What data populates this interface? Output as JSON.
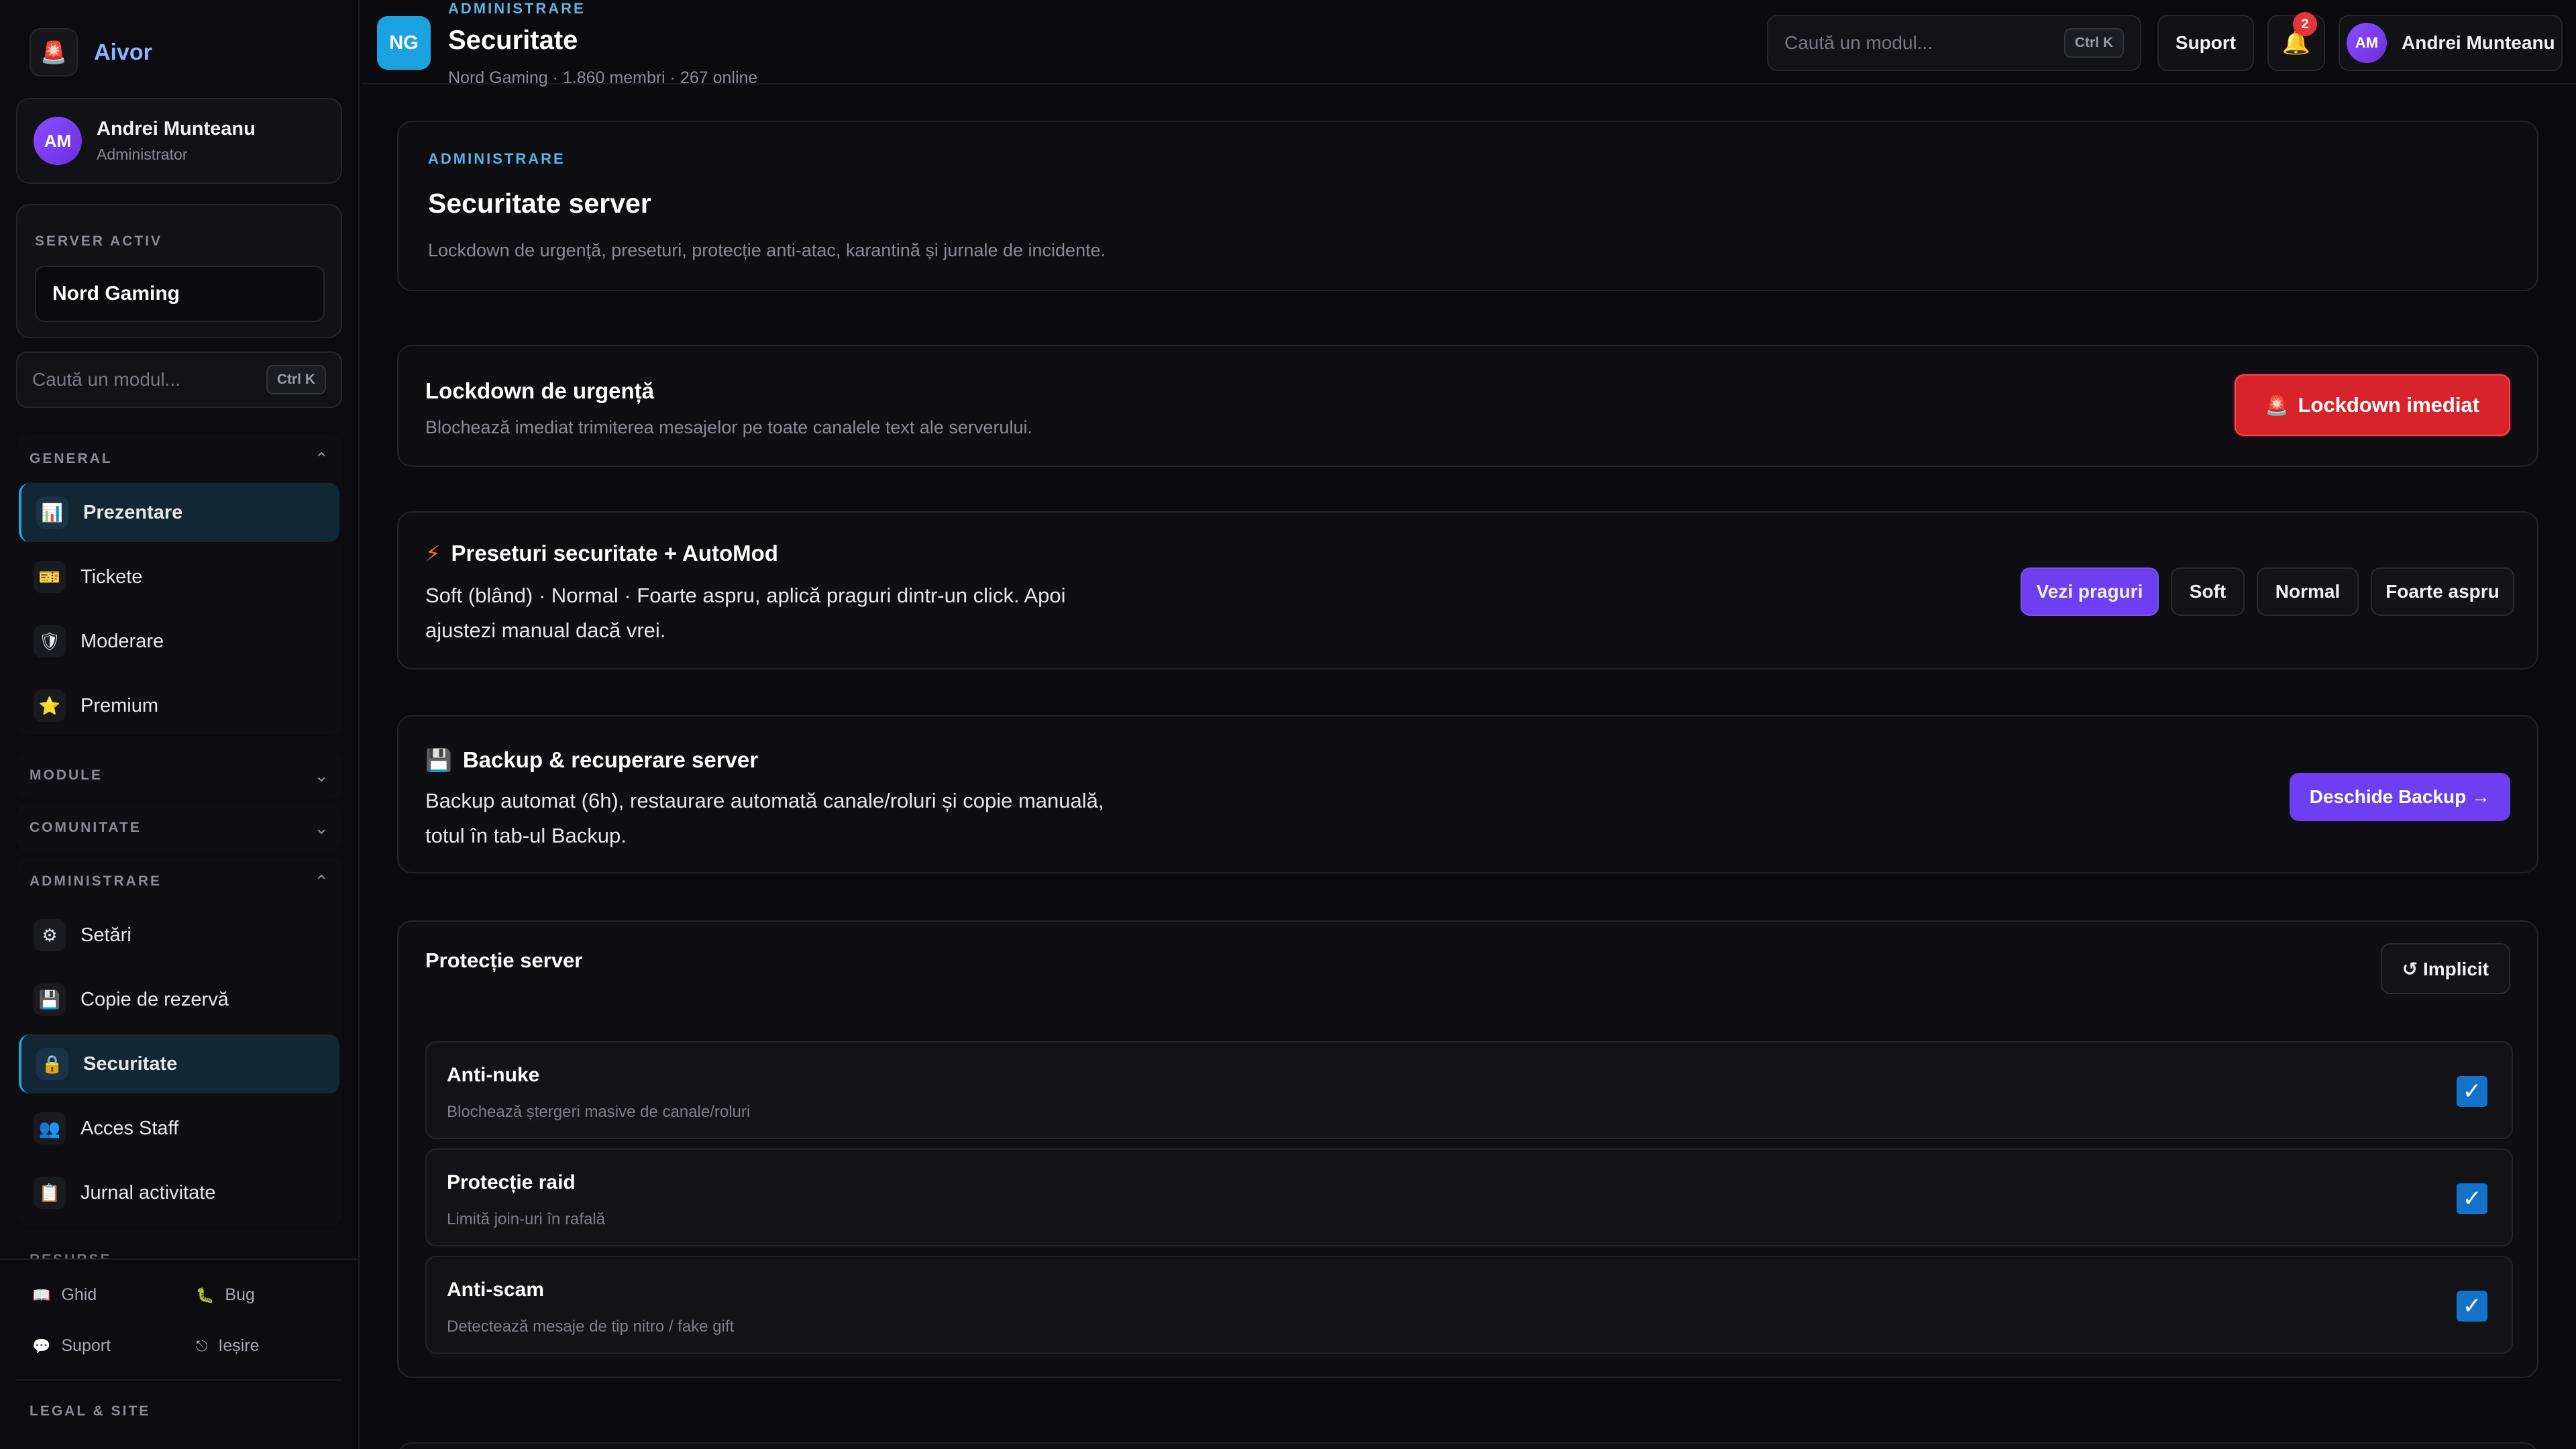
{
  "brand": {
    "name": "Aivor",
    "logo": "alarm-light-icon"
  },
  "user": {
    "initials": "AM",
    "name": "Andrei Munteanu",
    "role": "Administrator"
  },
  "server_panel": {
    "label": "SERVER ACTIV",
    "selected": "Nord Gaming"
  },
  "sidebar_search": {
    "placeholder": "Caută un modul...",
    "shortcut": "Ctrl K"
  },
  "nav": {
    "general": {
      "label": "GENERAL",
      "items": [
        {
          "label": "Prezentare",
          "icon": "bar-chart-icon",
          "glyph": "📊",
          "active": true
        },
        {
          "label": "Tickete",
          "icon": "ticket-icon",
          "glyph": "🎫",
          "active": false
        },
        {
          "label": "Moderare",
          "icon": "shield-icon",
          "glyph": "🛡",
          "active": false
        },
        {
          "label": "Premium",
          "icon": "star-icon",
          "glyph": "⭐",
          "active": false
        }
      ]
    },
    "module": {
      "label": "MODULE"
    },
    "comunitate": {
      "label": "COMUNITATE"
    },
    "administrare": {
      "label": "ADMINISTRARE",
      "items": [
        {
          "label": "Setări",
          "icon": "gear-icon",
          "glyph": "⚙",
          "active": false
        },
        {
          "label": "Copie de rezervă",
          "icon": "floppy-disk-icon",
          "glyph": "💾",
          "active": false
        },
        {
          "label": "Securitate",
          "icon": "lock-icon",
          "glyph": "🔒",
          "active": true
        },
        {
          "label": "Acces Staff",
          "icon": "people-icon",
          "glyph": "👥",
          "active": false
        },
        {
          "label": "Jurnal activitate",
          "icon": "clipboard-icon",
          "glyph": "📋",
          "active": false
        }
      ]
    }
  },
  "resources": {
    "label": "RESURSE",
    "links": [
      {
        "label": "Ghid",
        "icon": "book-icon",
        "glyph": "📖"
      },
      {
        "label": "Bug",
        "icon": "bug-icon",
        "glyph": "🐛"
      },
      {
        "label": "Suport",
        "icon": "speech-bubble-icon",
        "glyph": "💬"
      },
      {
        "label": "Ieșire",
        "icon": "logout-icon",
        "glyph": "⎋"
      }
    ]
  },
  "legal": {
    "label": "LEGAL & SITE"
  },
  "topbar": {
    "badge": "NG",
    "kicker": "ADMINISTRARE",
    "title": "Securitate",
    "subtitle": "Nord Gaming · 1.860 membri · 267 online",
    "search_placeholder": "Caută un modul...",
    "search_shortcut": "Ctrl K",
    "support_label": "Suport",
    "notification_count": "2",
    "user_initials": "AM",
    "user_name": "Andrei Munteanu"
  },
  "header_card": {
    "kicker": "ADMINISTRARE",
    "title": "Securitate server",
    "description": "Lockdown de urgență, preseturi, protecție anti-atac, karantină și jurnale de incidente."
  },
  "lockdown_card": {
    "title": "Lockdown de urgență",
    "description": "Blochează imediat trimiterea mesajelor pe toate canalele text ale serverului.",
    "button_label": "Lockdown imediat",
    "button_icon": "🚨"
  },
  "presets_card": {
    "icon": "⚡",
    "title": "Preseturi securitate + AutoMod",
    "text_line1": "Soft (blând) · Normal · Foarte aspru, aplică praguri dintr-un click. Apoi",
    "text_line2": "ajustezi manual dacă vrei.",
    "buttons": [
      "Vezi praguri",
      "Soft",
      "Normal",
      "Foarte aspru"
    ]
  },
  "backup_card": {
    "icon": "💾",
    "title": "Backup & recuperare server",
    "text_line1": "Backup automat (6h), restaurare automată canale/roluri și copie manuală,",
    "text_line2": "totul în tab-ul Backup.",
    "button_label": "Deschide Backup →"
  },
  "protection_card": {
    "title": "Protecție server",
    "reset_label": "↺ Implicit",
    "toggles": [
      {
        "title": "Anti-nuke",
        "description": "Blochează ștergeri masive de canale/roluri",
        "checked": true
      },
      {
        "title": "Protecție raid",
        "description": "Limită join-uri în rafală",
        "checked": true
      },
      {
        "title": "Anti-scam",
        "description": "Detectează mesaje de tip nitro / fake gift",
        "checked": true
      }
    ]
  },
  "colors": {
    "accent_blue": "#1aa3e0",
    "accent_purple": "#6d3ff0",
    "danger_red": "#d8232b",
    "background": "#0b0b0e"
  }
}
